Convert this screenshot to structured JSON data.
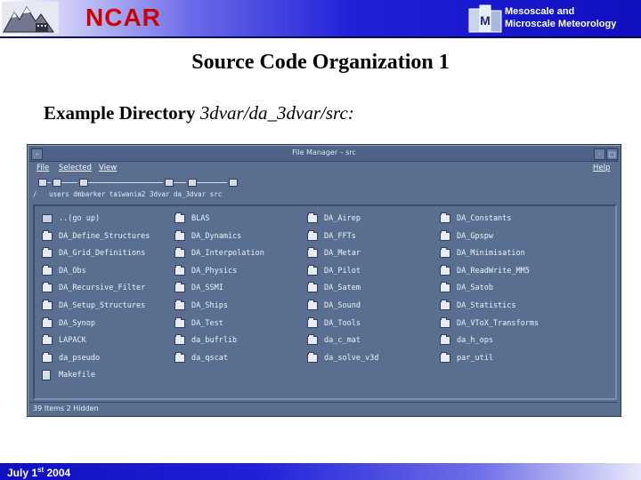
{
  "header": {
    "org": "NCAR",
    "division_line1": "Mesoscale and",
    "division_line2": "Microscale Meteorology"
  },
  "slide": {
    "title": "Source Code Organization 1",
    "subtitle_label": "Example Directory",
    "subtitle_path": "3dvar/da_3dvar/src:"
  },
  "file_manager": {
    "window_title": "File Manager – src",
    "menus": {
      "file": "File",
      "selected": "Selected",
      "view": "View",
      "help": "Help"
    },
    "path": "/   users dmbarker taiwania2 3dvar da_3dvar src",
    "items": [
      {
        "name": "..(go up)",
        "icon": "go-up-icon"
      },
      {
        "name": "BLAS",
        "icon": "folder-icon"
      },
      {
        "name": "DA_Airep",
        "icon": "folder-icon"
      },
      {
        "name": "DA_Constants",
        "icon": "folder-icon"
      },
      {
        "name": "DA_Define_Structures",
        "icon": "folder-icon"
      },
      {
        "name": "DA_Dynamics",
        "icon": "folder-icon"
      },
      {
        "name": "DA_FFTs",
        "icon": "folder-icon"
      },
      {
        "name": "DA_Gpspw",
        "icon": "folder-icon"
      },
      {
        "name": "DA_Grid_Definitions",
        "icon": "folder-icon"
      },
      {
        "name": "DA_Interpolation",
        "icon": "folder-icon"
      },
      {
        "name": "DA_Metar",
        "icon": "folder-icon"
      },
      {
        "name": "DA_Minimisation",
        "icon": "folder-icon"
      },
      {
        "name": "DA_Obs",
        "icon": "folder-icon"
      },
      {
        "name": "DA_Physics",
        "icon": "folder-icon"
      },
      {
        "name": "DA_Pilot",
        "icon": "folder-icon"
      },
      {
        "name": "DA_ReadWrite_MM5",
        "icon": "folder-icon"
      },
      {
        "name": "DA_Recursive_Filter",
        "icon": "folder-icon"
      },
      {
        "name": "DA_SSMI",
        "icon": "folder-icon"
      },
      {
        "name": "DA_Satem",
        "icon": "folder-icon"
      },
      {
        "name": "DA_Satob",
        "icon": "folder-icon"
      },
      {
        "name": "DA_Setup_Structures",
        "icon": "folder-icon"
      },
      {
        "name": "DA_Ships",
        "icon": "folder-icon"
      },
      {
        "name": "DA_Sound",
        "icon": "folder-icon"
      },
      {
        "name": "DA_Statistics",
        "icon": "folder-icon"
      },
      {
        "name": "DA_Synop",
        "icon": "folder-icon"
      },
      {
        "name": "DA_Test",
        "icon": "folder-icon"
      },
      {
        "name": "DA_Tools",
        "icon": "folder-icon"
      },
      {
        "name": "DA_VToX_Transforms",
        "icon": "folder-icon"
      },
      {
        "name": "LAPACK",
        "icon": "folder-icon"
      },
      {
        "name": "da_bufrlib",
        "icon": "folder-icon"
      },
      {
        "name": "da_c_mat",
        "icon": "folder-icon"
      },
      {
        "name": "da_h_ops",
        "icon": "folder-icon"
      },
      {
        "name": "da_pseudo",
        "icon": "folder-icon"
      },
      {
        "name": "da_qscat",
        "icon": "folder-icon"
      },
      {
        "name": "da_solve_v3d",
        "icon": "folder-icon"
      },
      {
        "name": "par_util",
        "icon": "folder-icon"
      },
      {
        "name": "Makefile",
        "icon": "file-icon"
      }
    ],
    "status": "39 Items 2 Hidden"
  },
  "footer": {
    "date_pre": "July 1",
    "date_sup": "st",
    "date_post": " 2004"
  }
}
